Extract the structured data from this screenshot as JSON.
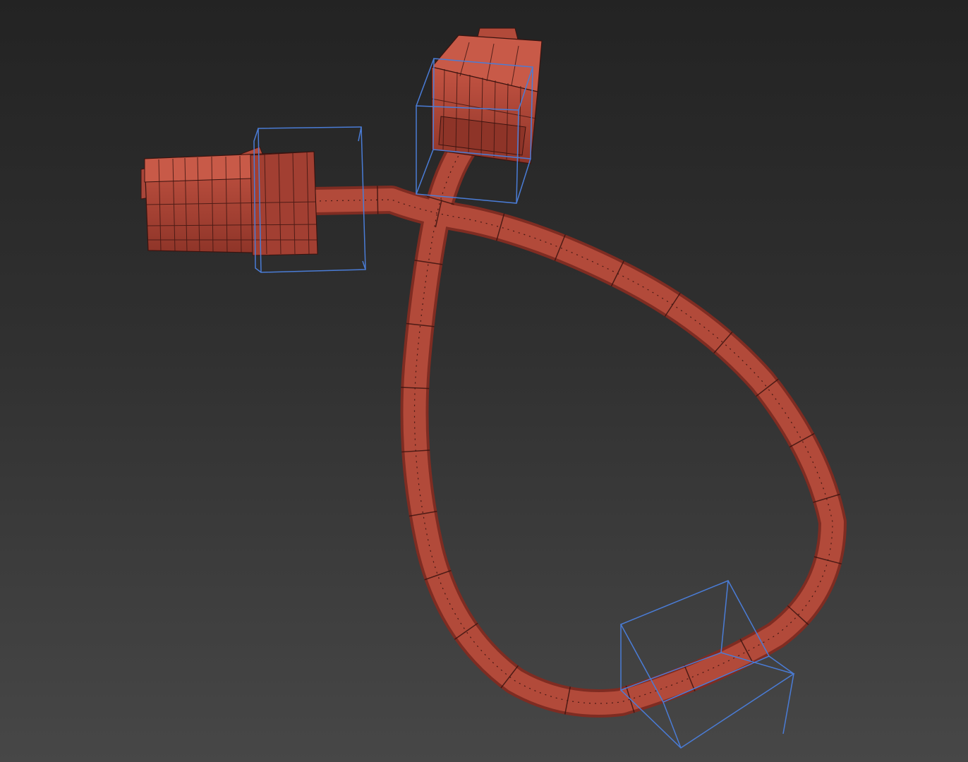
{
  "viewport": {
    "label": "",
    "background_top": "#232323",
    "background_bottom": "#474747"
  },
  "scene": {
    "objects": [
      {
        "name": "rj45-plug-left",
        "type": "connector"
      },
      {
        "name": "rj45-plug-top",
        "type": "connector"
      },
      {
        "name": "network-cable",
        "type": "cable"
      },
      {
        "name": "gizmo-box-left",
        "type": "bounding-box"
      },
      {
        "name": "gizmo-box-top",
        "type": "bounding-box"
      },
      {
        "name": "gizmo-box-bottom",
        "type": "bounding-box"
      }
    ],
    "mesh_color": "#b24a3a",
    "mesh_shadow_color": "#7f2c22",
    "wire_color": "#3a130f",
    "gizmo_color": "#4a7cd6"
  }
}
